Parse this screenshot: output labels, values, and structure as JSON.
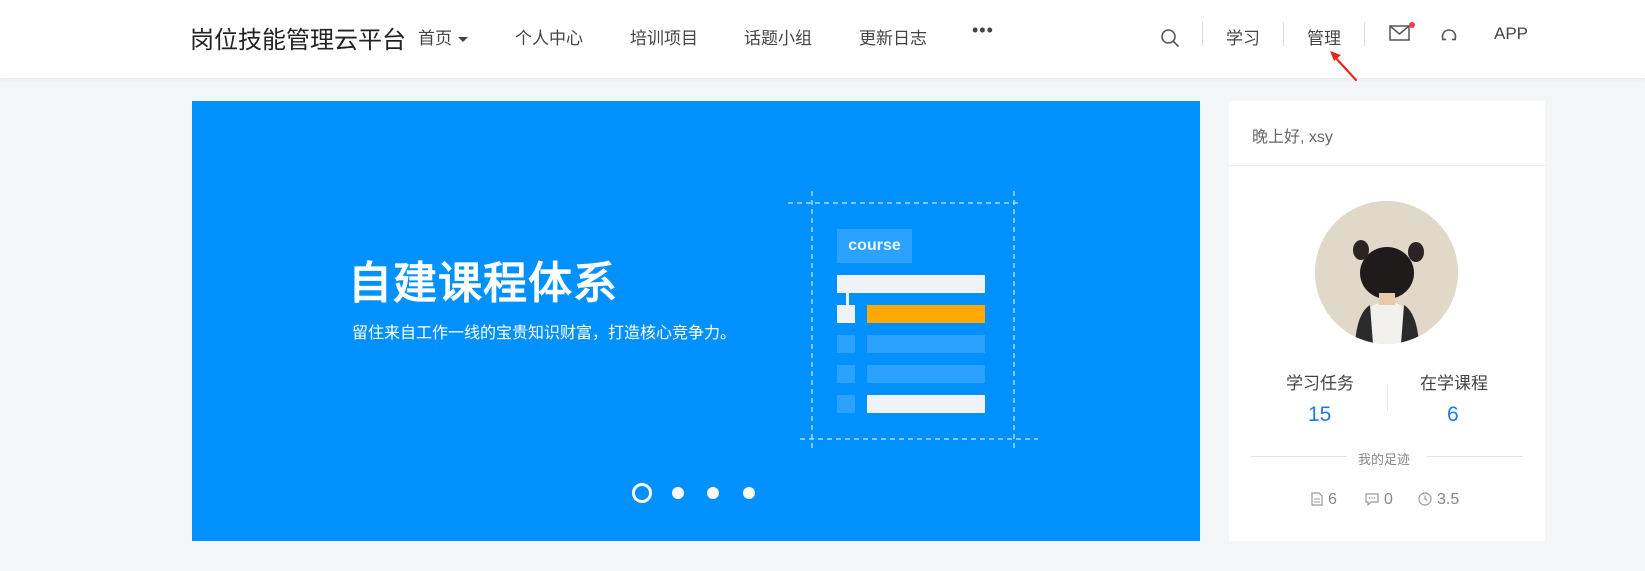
{
  "header": {
    "logo": "岗位技能管理云平台",
    "nav": [
      {
        "label": "首页"
      },
      {
        "label": "个人中心"
      },
      {
        "label": "培训项目"
      },
      {
        "label": "话题小组"
      },
      {
        "label": "更新日志"
      }
    ],
    "more": "•••",
    "right": {
      "learn": "学习",
      "manage": "管理",
      "app": "APP"
    },
    "icons": [
      "search-icon",
      "mail-icon",
      "headset-icon",
      "caret-down-icon",
      "more-icon"
    ],
    "notification_dot_color": "#f03e3e"
  },
  "banner": {
    "title": "自建课程体系",
    "subtitle": "留住来自工作一线的宝贵知识财富，打造核心竞争力。",
    "course_label": "course",
    "background": "#0091ff",
    "highlight_color": "#ffa800",
    "slides_total": 4,
    "active_slide": 1
  },
  "sidebar": {
    "greeting": "晚上好, xsy",
    "stats": [
      {
        "label": "学习任务",
        "value": "15"
      },
      {
        "label": "在学课程",
        "value": "6"
      }
    ],
    "footprint_label": "我的足迹",
    "metrics": [
      {
        "icon": "document-icon",
        "value": "6"
      },
      {
        "icon": "comment-icon",
        "value": "0"
      },
      {
        "icon": "clock-icon",
        "value": "3.5"
      }
    ],
    "accent": "#1f7be6"
  }
}
